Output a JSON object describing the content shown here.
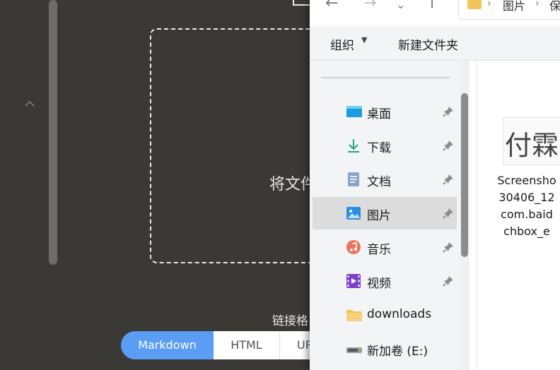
{
  "background_app": {
    "drop_text": "将文件",
    "link_format_label": "链接格",
    "formats": {
      "markdown": "Markdown",
      "html": "HTML",
      "url": "UR"
    }
  },
  "explorer": {
    "address": {
      "folder1": "图片",
      "folder2": "保"
    },
    "toolbar": {
      "organize": "组织",
      "new_folder": "新建文件夹"
    },
    "nav_items": [
      {
        "label": "桌面",
        "icon": "desktop-icon",
        "pinned": true
      },
      {
        "label": "下载",
        "icon": "download-icon",
        "pinned": true
      },
      {
        "label": "文档",
        "icon": "document-icon",
        "pinned": true
      },
      {
        "label": "图片",
        "icon": "pictures-icon",
        "pinned": true,
        "selected": true
      },
      {
        "label": "音乐",
        "icon": "music-icon",
        "pinned": true
      },
      {
        "label": "视频",
        "icon": "video-icon",
        "pinned": true
      },
      {
        "label": "downloads",
        "icon": "folder-icon",
        "pinned": false
      },
      {
        "label": "新加卷 (E:)",
        "icon": "drive-icon",
        "pinned": false
      }
    ],
    "file": {
      "name_lines": [
        "Screensho",
        "30406_12",
        "com.baid",
        "chbox_e"
      ],
      "thumbnail_text": "付霖"
    }
  },
  "colors": {
    "accent": "#5b9cf5",
    "selected": "#dcdcdc",
    "dark_bg": "#3b3936"
  }
}
